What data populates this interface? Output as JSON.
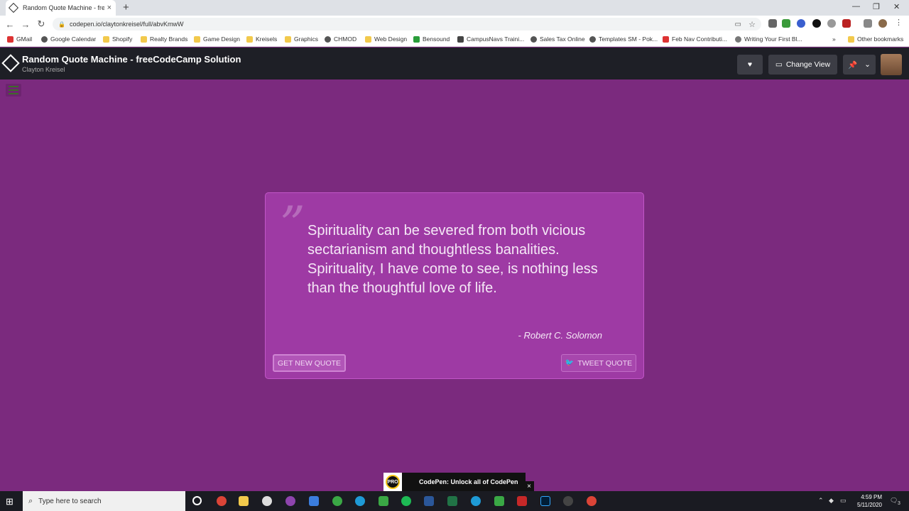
{
  "browser": {
    "tab_title": "Random Quote Machine - freeCodeCamp",
    "tab_close": "×",
    "new_tab": "+",
    "url": "codepen.io/claytonkreisel/full/abvKmwW",
    "bookmarks": [
      "GMail",
      "Google Calendar",
      "Shopify",
      "Realty Brands",
      "Game Design",
      "Kreisels",
      "Graphics",
      "CHMOD",
      "Web Design",
      "Bensound",
      "CampusNavs Traini...",
      "Sales Tax Online",
      "Templates SM - Pok...",
      "Feb Nav Contributi...",
      "Writing Your First Bl..."
    ],
    "more_bookmarks": "»",
    "other_bookmarks": "Other bookmarks"
  },
  "codepen": {
    "title": "Random Quote Machine - freeCodeCamp Solution",
    "author": "Clayton Kreisel",
    "change_view": "Change View"
  },
  "quote": {
    "mark": "”",
    "text": "Spirituality can be severed from both vicious sectarianism and thoughtless banalities. Spirituality, I have come to see, is nothing less than the thoughtful love of life.",
    "author": "- Robert C. Solomon",
    "new_quote_label": "GET NEW QUOTE",
    "tweet_label": "TWEET QUOTE"
  },
  "promo": {
    "badge": "PRO",
    "text": "CodePen: Unlock all of CodePen",
    "close": "×"
  },
  "taskbar": {
    "search_placeholder": "Type here to search",
    "time": "4:59 PM",
    "date": "5/11/2020",
    "notifications": "3"
  },
  "colors": {
    "page_bg": "#7b2a7e",
    "card_bg": "#9e3aa4",
    "header_bg": "#1e1f26"
  }
}
